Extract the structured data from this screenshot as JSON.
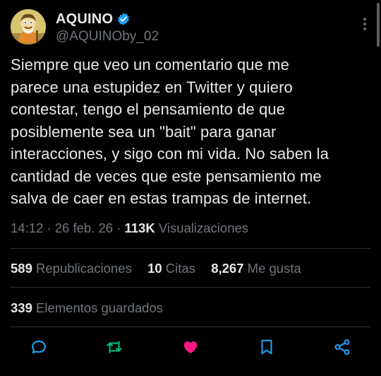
{
  "author": {
    "display_name": "AQUINO",
    "handle": "@AQUINOby_02",
    "avatar_icon": "cartoon-avatar",
    "verified_icon": "verified-badge-icon"
  },
  "tweet": {
    "text_lines": [
      "Siempre que veo un comentario que me",
      "parece una estupidez en Twitter y quiero",
      "contestar, tengo el pensamiento de que",
      "posiblemente sea un \"bait\" para ganar",
      "interacciones, y sigo con mi vida. No saben la",
      "cantidad de veces que este pensamiento me",
      "salva de caer en estas trampas de internet."
    ]
  },
  "meta": {
    "time": "14:12",
    "sep1": "·",
    "date": "26 feb. 26",
    "sep2": "·",
    "views_count": "113K",
    "views_label": "Visualizaciones"
  },
  "stats": {
    "reposts_count": "589",
    "reposts_label": "Republicaciones",
    "quotes_count": "10",
    "quotes_label": "Citas",
    "likes_count": "8,267",
    "likes_label": "Me gusta",
    "saves_count": "339",
    "saves_label": "Elementos guardados"
  },
  "actions": [
    "reply-icon",
    "repost-icon",
    "like-icon",
    "bookmark-icon",
    "share-icon"
  ],
  "colors": {
    "background": "#000000",
    "text": "#e7e9ea",
    "muted": "#71767b",
    "verified": "#1d9bf0",
    "like": "#f91880",
    "divider": "#2f3336"
  }
}
